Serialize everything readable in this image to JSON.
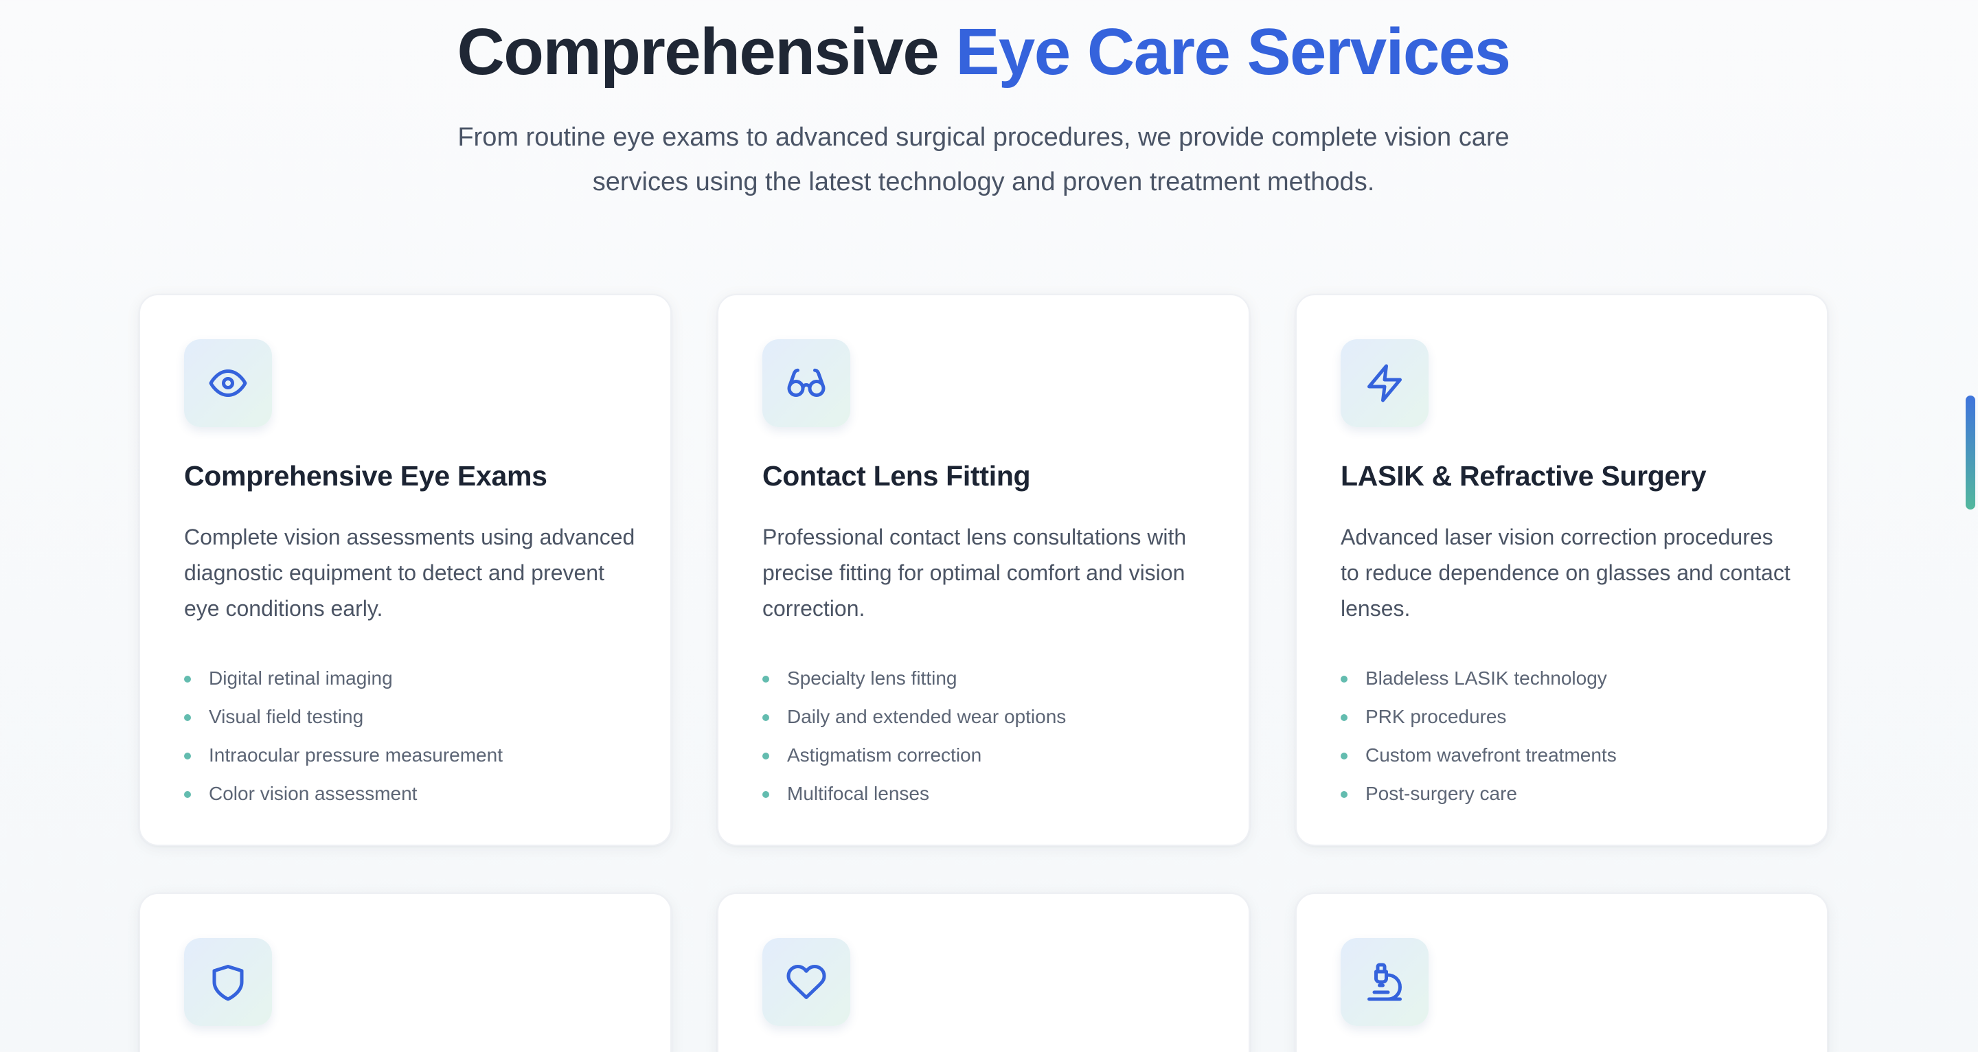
{
  "header": {
    "title_main": "Comprehensive",
    "title_accent": "Eye Care Services",
    "subtitle": "From routine eye exams to advanced surgical procedures, we provide complete vision care services using the latest technology and proven treatment methods."
  },
  "colors": {
    "accent": "#3563dc",
    "bullet": "#63bcaf",
    "heading": "#1f2735",
    "body_text": "#4b5464"
  },
  "services": [
    {
      "icon": "eye-icon",
      "title": "Comprehensive Eye Exams",
      "description": "Complete vision assessments using advanced diagnostic equipment to detect and prevent eye conditions early.",
      "features": [
        "Digital retinal imaging",
        "Visual field testing",
        "Intraocular pressure measurement",
        "Color vision assessment"
      ]
    },
    {
      "icon": "glasses-icon",
      "title": "Contact Lens Fitting",
      "description": "Professional contact lens consultations with precise fitting for optimal comfort and vision correction.",
      "features": [
        "Specialty lens fitting",
        "Daily and extended wear options",
        "Astigmatism correction",
        "Multifocal lenses"
      ]
    },
    {
      "icon": "lightning-icon",
      "title": "LASIK & Refractive Surgery",
      "description": "Advanced laser vision correction procedures to reduce dependence on glasses and contact lenses.",
      "features": [
        "Bladeless LASIK technology",
        "PRK procedures",
        "Custom wavefront treatments",
        "Post-surgery care"
      ]
    },
    {
      "icon": "shield-icon"
    },
    {
      "icon": "heart-icon"
    },
    {
      "icon": "microscope-icon"
    }
  ]
}
